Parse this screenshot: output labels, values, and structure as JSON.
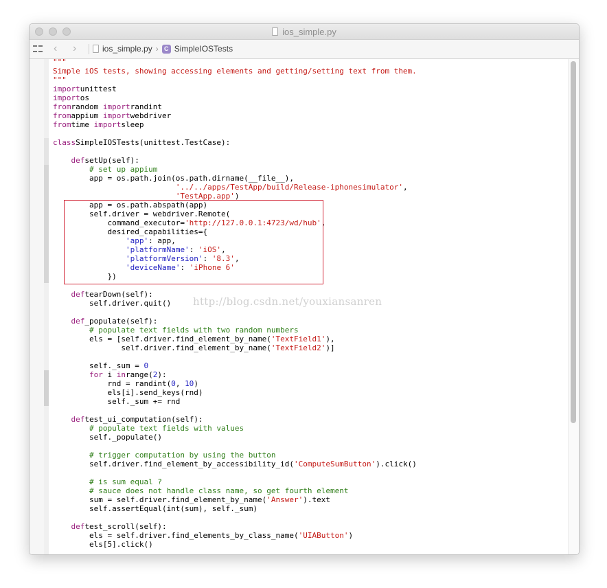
{
  "window": {
    "title": "ios_simple.py"
  },
  "jumpbar": {
    "back_glyph": "‹",
    "forward_glyph": "›",
    "crumbs": [
      {
        "label": "ios_simple.py",
        "icon": "python-file-icon"
      },
      {
        "label": "SimpleIOSTests",
        "icon": "class-icon",
        "glyph": "C"
      }
    ],
    "separator": "›"
  },
  "watermark": "http://blog.csdn.net/youxiansanren",
  "colors": {
    "keyword": "#9a1f7e",
    "string": "#c41a16",
    "dict_key": "#1e1ec0",
    "comment": "#2f7e19",
    "number": "#1e1ec0",
    "highlight_box": "#d2293a"
  },
  "code_lines": [
    [
      [
        "doc",
        "\"\"\""
      ]
    ],
    [
      [
        "doc",
        "Simple iOS tests, showing accessing elements and getting/setting text from them."
      ]
    ],
    [
      [
        "doc",
        "\"\"\""
      ]
    ],
    [
      [
        "kw",
        "import"
      ],
      [
        "",
        "unittest"
      ]
    ],
    [
      [
        "kw",
        "import"
      ],
      [
        "",
        "os"
      ]
    ],
    [
      [
        "kw",
        "from"
      ],
      [
        "",
        "random "
      ],
      [
        "kw",
        "import"
      ],
      [
        "",
        "randint"
      ]
    ],
    [
      [
        "kw",
        "from"
      ],
      [
        "",
        "appium "
      ],
      [
        "kw",
        "import"
      ],
      [
        "",
        "webdriver"
      ]
    ],
    [
      [
        "kw",
        "from"
      ],
      [
        "",
        "time "
      ],
      [
        "kw",
        "import"
      ],
      [
        "",
        "sleep"
      ]
    ],
    [],
    [
      [
        "kw",
        "class"
      ],
      [
        "",
        "SimpleIOSTests(unittest.TestCase):"
      ]
    ],
    [],
    [
      [
        "",
        "    "
      ],
      [
        "kw",
        "def"
      ],
      [
        "",
        "setUp(self):"
      ]
    ],
    [
      [
        "",
        "        "
      ],
      [
        "cm",
        "# set up appium"
      ]
    ],
    [
      [
        "",
        "        app = os.path.join(os.path.dirname(__file__),"
      ]
    ],
    [
      [
        "",
        "                           "
      ],
      [
        "str",
        "'../../apps/TestApp/build/Release-iphonesimulator'"
      ],
      [
        "",
        ","
      ]
    ],
    [
      [
        "",
        "                           "
      ],
      [
        "str",
        "'TestApp.app'"
      ],
      [
        "",
        ")"
      ]
    ],
    [
      [
        "",
        "        app = os.path.abspath(app)"
      ]
    ],
    [
      [
        "",
        "        self.driver = webdriver.Remote("
      ]
    ],
    [
      [
        "",
        "            command_executor="
      ],
      [
        "str",
        "'http://127.0.0.1:4723/wd/hub'"
      ],
      [
        "",
        ","
      ]
    ],
    [
      [
        "",
        "            desired_capabilities={"
      ]
    ],
    [
      [
        "",
        "                "
      ],
      [
        "strd",
        "'app'"
      ],
      [
        "",
        ": app,"
      ]
    ],
    [
      [
        "",
        "                "
      ],
      [
        "strd",
        "'platformName'"
      ],
      [
        "",
        ": "
      ],
      [
        "str",
        "'iOS'"
      ],
      [
        "",
        ","
      ]
    ],
    [
      [
        "",
        "                "
      ],
      [
        "strd",
        "'platformVersion'"
      ],
      [
        "",
        ": "
      ],
      [
        "str",
        "'8.3'"
      ],
      [
        "",
        ","
      ]
    ],
    [
      [
        "",
        "                "
      ],
      [
        "strd",
        "'deviceName'"
      ],
      [
        "",
        ": "
      ],
      [
        "str",
        "'iPhone 6'"
      ]
    ],
    [
      [
        "",
        "            })"
      ]
    ],
    [],
    [
      [
        "",
        "    "
      ],
      [
        "kw",
        "def"
      ],
      [
        "",
        "tearDown(self):"
      ]
    ],
    [
      [
        "",
        "        self.driver.quit()"
      ]
    ],
    [],
    [
      [
        "",
        "    "
      ],
      [
        "kw",
        "def"
      ],
      [
        "",
        "_populate(self):"
      ]
    ],
    [
      [
        "",
        "        "
      ],
      [
        "cm",
        "# populate text fields with two random numbers"
      ]
    ],
    [
      [
        "",
        "        els = [self.driver.find_element_by_name("
      ],
      [
        "str",
        "'TextField1'"
      ],
      [
        "",
        "),"
      ]
    ],
    [
      [
        "",
        "               self.driver.find_element_by_name("
      ],
      [
        "str",
        "'TextField2'"
      ],
      [
        "",
        ")]"
      ]
    ],
    [],
    [
      [
        "",
        "        self._sum = "
      ],
      [
        "num",
        "0"
      ]
    ],
    [
      [
        "",
        "        "
      ],
      [
        "kw",
        "for"
      ],
      [
        "",
        " i "
      ],
      [
        "kw",
        "in"
      ],
      [
        "",
        ""
      ],
      [
        "",
        "range("
      ],
      [
        "num",
        "2"
      ],
      [
        "",
        "):"
      ]
    ],
    [
      [
        "",
        "            rnd = randint("
      ],
      [
        "num",
        "0"
      ],
      [
        "",
        ", "
      ],
      [
        "num",
        "10"
      ],
      [
        "",
        ")"
      ]
    ],
    [
      [
        "",
        "            els[i].send_keys(rnd)"
      ]
    ],
    [
      [
        "",
        "            self._sum += rnd"
      ]
    ],
    [],
    [
      [
        "",
        "    "
      ],
      [
        "kw",
        "def"
      ],
      [
        "",
        "test_ui_computation(self):"
      ]
    ],
    [
      [
        "",
        "        "
      ],
      [
        "cm",
        "# populate text fields with values"
      ]
    ],
    [
      [
        "",
        "        self._populate()"
      ]
    ],
    [],
    [
      [
        "",
        "        "
      ],
      [
        "cm",
        "# trigger computation by using the button"
      ]
    ],
    [
      [
        "",
        "        self.driver.find_element_by_accessibility_id("
      ],
      [
        "str",
        "'ComputeSumButton'"
      ],
      [
        "",
        ").click()"
      ]
    ],
    [],
    [
      [
        "",
        "        "
      ],
      [
        "cm",
        "# is sum equal ?"
      ]
    ],
    [
      [
        "",
        "        "
      ],
      [
        "cm",
        "# sauce does not handle class name, so get fourth element"
      ]
    ],
    [
      [
        "",
        "        sum = self.driver.find_element_by_name("
      ],
      [
        "str",
        "'Answer'"
      ],
      [
        "",
        ").text"
      ]
    ],
    [
      [
        "",
        "        self.assertEqual(int(sum), self._sum)"
      ]
    ],
    [],
    [
      [
        "",
        "    "
      ],
      [
        "kw",
        "def"
      ],
      [
        "",
        "test_scroll(self):"
      ]
    ],
    [
      [
        "",
        "        els = self.driver.find_elements_by_class_name("
      ],
      [
        "str",
        "'UIAButton'"
      ],
      [
        "",
        ")"
      ]
    ],
    [
      [
        "",
        "        els[5].click()"
      ]
    ]
  ]
}
